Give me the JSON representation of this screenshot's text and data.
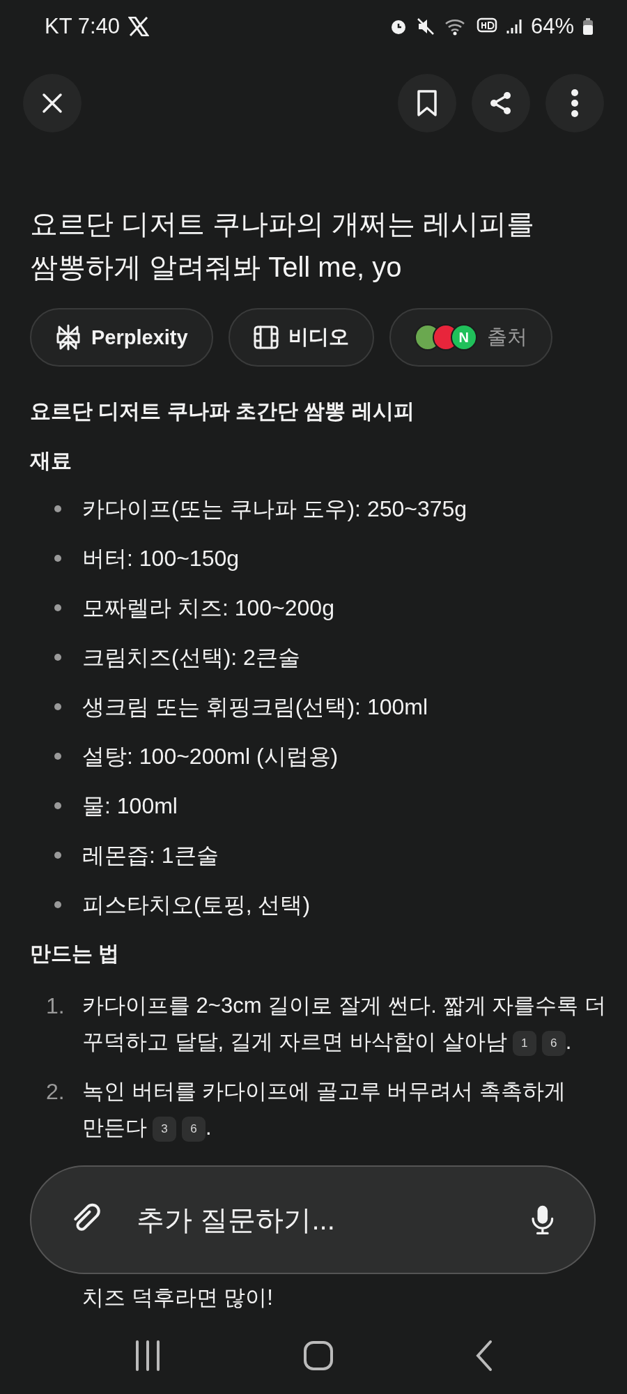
{
  "status_bar": {
    "carrier_time": "KT 7:40",
    "battery": "64%"
  },
  "title": "요르단 디저트 쿠나파의 개쩌는 레시피를 쌈뽕하게 알려줘봐 Tell me, yo",
  "chips": [
    {
      "kind": "perplexity",
      "label": "Perplexity"
    },
    {
      "kind": "video",
      "label": "비디오"
    },
    {
      "kind": "sources",
      "label": "출처",
      "sources": [
        {
          "color": "#6aa84f"
        },
        {
          "color": "#e8253b"
        },
        {
          "color": "#20c05a",
          "label": "N"
        }
      ]
    }
  ],
  "answer": {
    "heading": "요르단 디저트 쿠나파 초간단 쌈뽕 레시피",
    "ingredients_title": "재료",
    "ingredients": [
      "카다이프(또는 쿠나파 도우): 250~375g",
      "버터: 100~150g",
      "모짜렐라 치즈: 100~200g",
      "크림치즈(선택): 2큰술",
      "생크림 또는 휘핑크림(선택): 100ml",
      "설탕: 100~200ml (시럽용)",
      "물: 100ml",
      "레몬즙: 1큰술",
      "피스타치오(토핑, 선택)"
    ],
    "steps_title": "만드는 법",
    "steps": [
      {
        "number": "1.",
        "text": "카다이프를 2~3cm 길이로 잘게 썬다. 짧게 자를수록 더 꾸덕하고 달달, 길게 자르면 바삭함이 살아남",
        "citations": [
          "1",
          "6"
        ],
        "end": "."
      },
      {
        "number": "2.",
        "text": "녹인 버터를 카다이프에 골고루 버무려서 촉촉하게 만든다",
        "citations": [
          "3",
          "6"
        ],
        "end": "."
      },
      {
        "text": "치즈 덕후라면 많이!"
      }
    ]
  },
  "followup": {
    "placeholder": "추가 질문하기..."
  }
}
